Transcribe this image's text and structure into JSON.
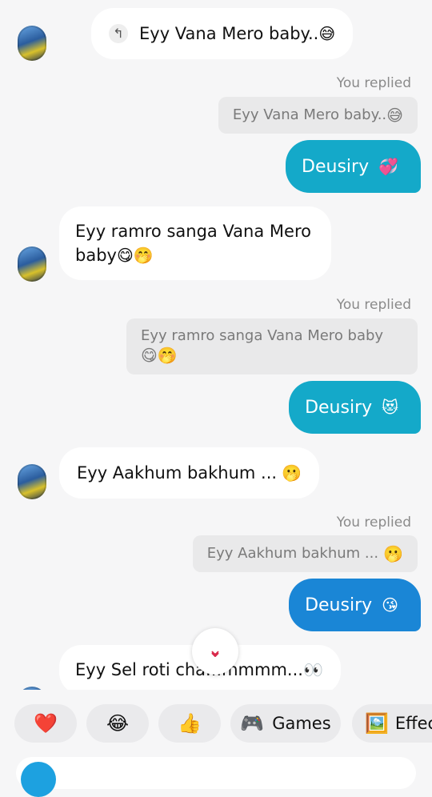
{
  "thread": {
    "messages": [
      {
        "text": "Eyy Vana Mero baby..",
        "emoji": "😅"
      },
      {
        "you_replied": "You replied",
        "quote": "Eyy Vana Mero baby..",
        "quote_emoji": "😅",
        "reply": "Deusiry",
        "reply_emoji": "💞"
      },
      {
        "text": "Eyy ramro sanga Vana Mero baby",
        "emoji": "😋🤭"
      },
      {
        "you_replied": "You replied",
        "quote": "Eyy ramro sanga Vana Mero baby",
        "quote_emoji": "😋🤭",
        "reply": "Deusiry",
        "reply_emoji": "😻"
      },
      {
        "text": "Eyy Aakhum bakhum ...",
        "emoji": "🫢"
      },
      {
        "you_replied": "You replied",
        "quote": "Eyy Aakhum bakhum ...",
        "quote_emoji": "🫢",
        "reply": "Deusiry",
        "reply_emoji": "😘"
      },
      {
        "text": "Eyy Sel roti cha...mmmm...",
        "emoji": "👀"
      }
    ],
    "colors": {
      "reply_bubble_teal": "#14a9c9",
      "reply_bubble_blue": "#1a86d6"
    }
  },
  "quick_reactions": [
    {
      "label": "",
      "icon": "heart-icon",
      "glyph": "❤️"
    },
    {
      "label": "",
      "icon": "laugh-icon",
      "glyph": "😂"
    },
    {
      "label": "",
      "icon": "thumbs-up-icon",
      "glyph": "👍"
    },
    {
      "label": "Games",
      "icon": "gamepad-icon",
      "glyph": "🎮"
    },
    {
      "label": "Effec",
      "icon": "effects-icon",
      "glyph": "🖼️"
    }
  ],
  "scroll_button": {
    "icon": "double-chevron-down-icon",
    "glyph": "⌄"
  }
}
